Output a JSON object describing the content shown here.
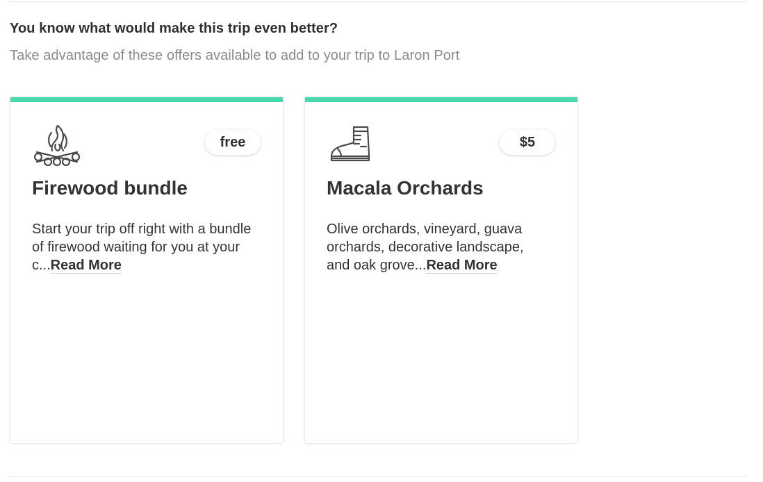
{
  "section": {
    "heading": "You know what would make this trip even better?",
    "subheading": "Take advantage of these offers available to add to your trip to Laron Port"
  },
  "theme": {
    "accent_color": "#48d8ad",
    "text_color": "#333333",
    "muted_text_color": "#8a8a8a"
  },
  "offers": [
    {
      "icon": "campfire-icon",
      "price": "free",
      "title": "Firewood bundle",
      "description": "Start your trip off right with a bundle of firewood waiting for you at your c...",
      "read_more": "Read More"
    },
    {
      "icon": "hiking-boot-icon",
      "price": "$5",
      "title": "Macala Orchards",
      "description": "Olive orchards, vineyard, guava orchards, decorative landscape, and oak grove...",
      "read_more": "Read More"
    }
  ]
}
